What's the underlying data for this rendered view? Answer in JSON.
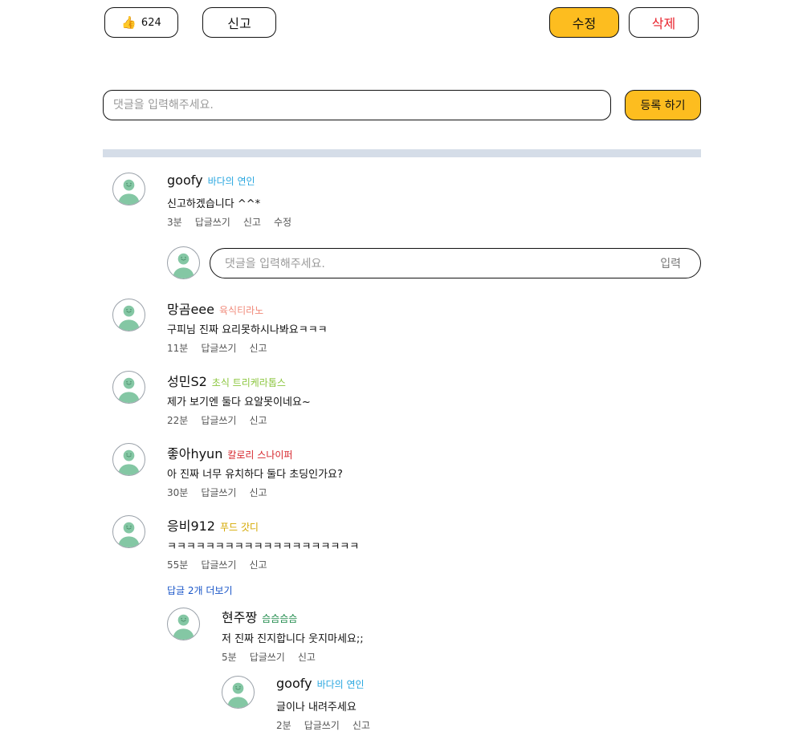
{
  "top_bar": {
    "like_icon": "thumbs-up-icon",
    "like_count": "624",
    "report_label": "신고",
    "edit_label": "수정",
    "delete_label": "삭제"
  },
  "comment_form": {
    "placeholder": "댓글을 입력해주세요.",
    "submit_label": "등록 하기"
  },
  "colors": {
    "accent_yellow": "#fdbd1f",
    "delete_red": "#e8202a",
    "divider": "#d5dde8",
    "link_blue": "#1a56c8"
  },
  "comments": [
    {
      "nickname": "goofy",
      "badge": "바다의 연인",
      "badge_color": "#2aa7e0",
      "text": "신고하겠습니다 ^^*",
      "time": "3분",
      "reply_label": "답글쓰기",
      "report_label": "신고",
      "edit_label": "수정"
    },
    {
      "nickname": "망곰eee",
      "badge": "육식티라노",
      "badge_color": "#f08a7a",
      "text": "구피님 진짜 요리못하시나봐요ㅋㅋㅋ",
      "time": "11분",
      "reply_label": "답글쓰기",
      "report_label": "신고"
    },
    {
      "nickname": "성민S2",
      "badge": "초식 트리케라톱스",
      "badge_color": "#8cc63f",
      "text": "제가 보기엔 둘다 요알못이네요~",
      "time": "22분",
      "reply_label": "답글쓰기",
      "report_label": "신고"
    },
    {
      "nickname": "좋아hyun",
      "badge": "칼로리 스나이퍼",
      "badge_color": "#d6232a",
      "text": "아 진짜 너무 유치하다 둘다 초딩인가요?",
      "time": "30분",
      "reply_label": "답글쓰기",
      "report_label": "신고"
    },
    {
      "nickname": "응비912",
      "badge": "푸드 갓디",
      "badge_color": "#d4a800",
      "text": "ㅋㅋㅋㅋㅋㅋㅋㅋㅋㅋㅋㅋㅋㅋㅋㅋㅋㅋㅋㅋ",
      "time": "55분",
      "reply_label": "답글쓰기",
      "report_label": "신고"
    }
  ],
  "reply_form": {
    "placeholder": "댓글을 입력해주세요.",
    "submit_label": "입력"
  },
  "more_replies_label": "답글 2개 더보기",
  "replies": [
    {
      "nickname": "현주짱",
      "badge": "슴슴슴슴",
      "badge_color": "#1e8a4a",
      "text": "저 진짜 진지합니다 웃지마세요;;",
      "time": "5분",
      "reply_label": "답글쓰기",
      "report_label": "신고"
    },
    {
      "nickname": "goofy",
      "badge": "바다의 연인",
      "badge_color": "#2aa7e0",
      "text": "글이나 내려주세요",
      "time": "2분",
      "reply_label": "답글쓰기",
      "report_label": "신고"
    }
  ]
}
